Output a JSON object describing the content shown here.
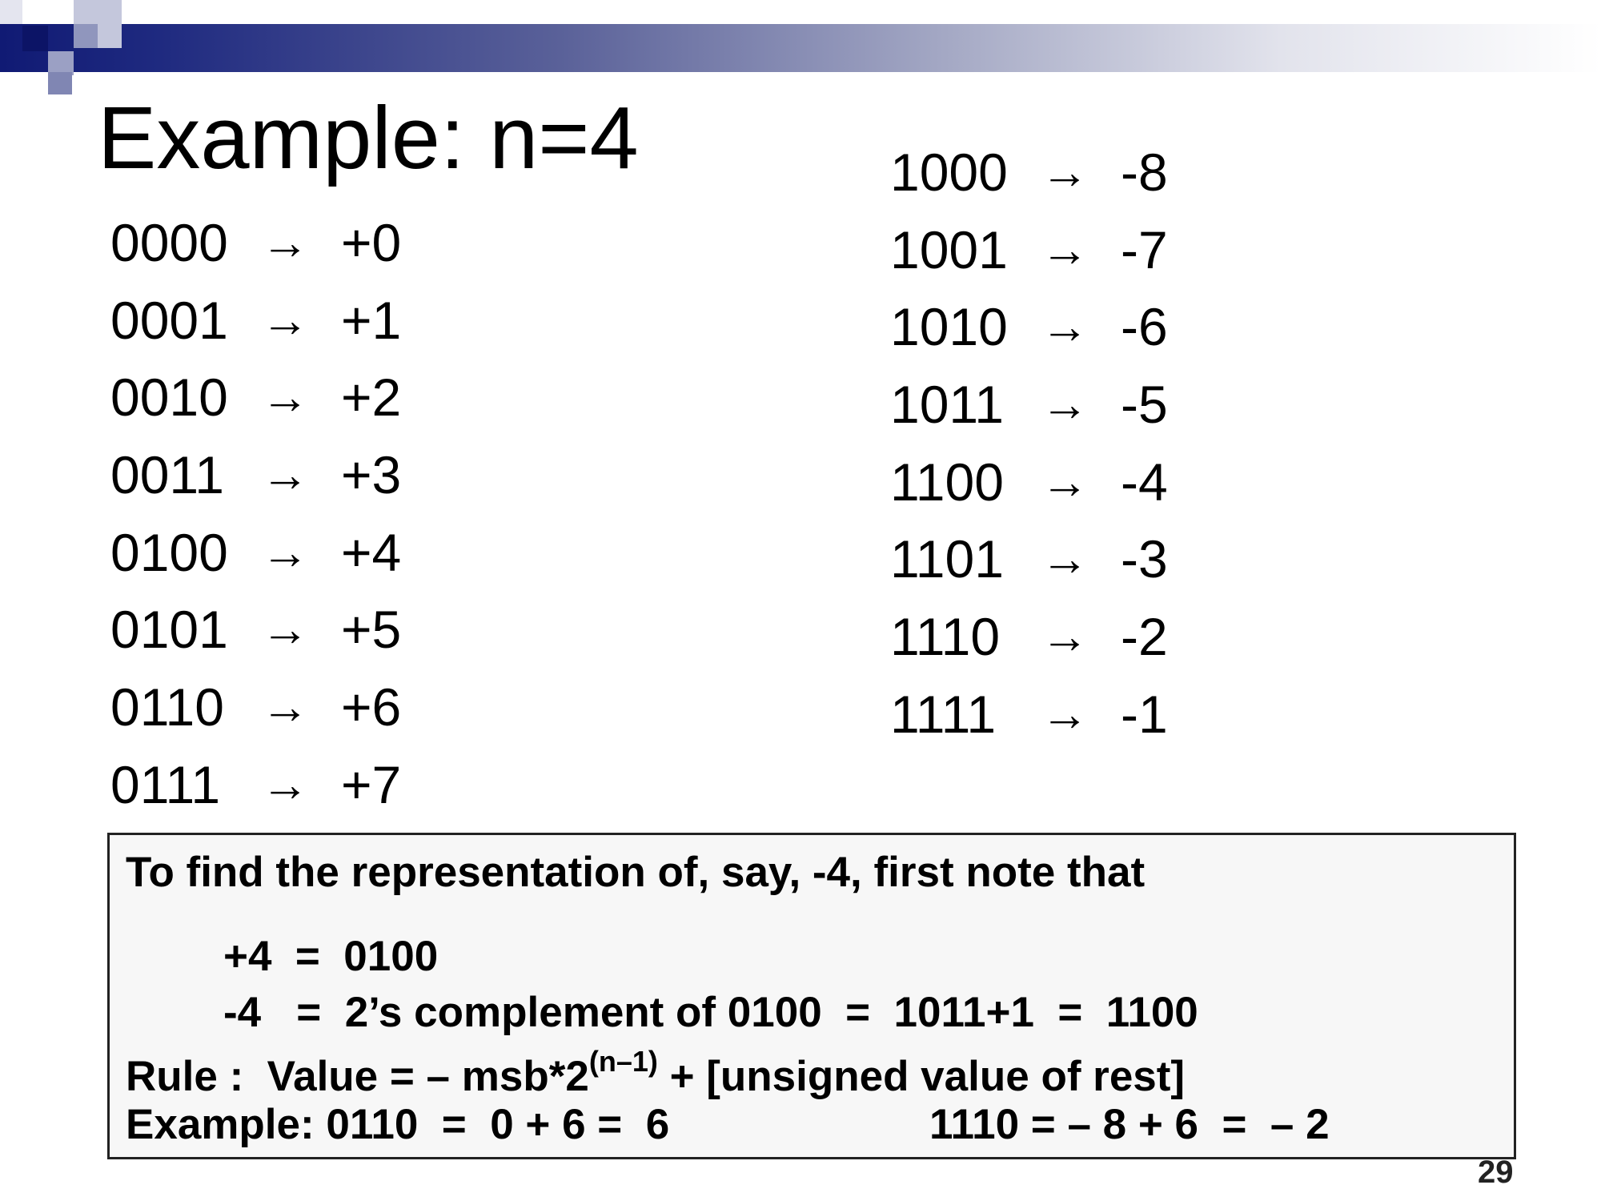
{
  "slide": {
    "title": "Example:  n=4",
    "page_number": "29"
  },
  "mapping": {
    "arrow": "→",
    "left": [
      {
        "bits": "0000",
        "value": "+0"
      },
      {
        "bits": "0001",
        "value": "+1"
      },
      {
        "bits": "0010",
        "value": "+2"
      },
      {
        "bits": "0011",
        "value": "+3"
      },
      {
        "bits": "0100",
        "value": "+4"
      },
      {
        "bits": "0101",
        "value": "+5"
      },
      {
        "bits": "0110",
        "value": "+6"
      },
      {
        "bits": "0111",
        "value": "+7"
      }
    ],
    "right": [
      {
        "bits": "1000",
        "value": "-8"
      },
      {
        "bits": "1001",
        "value": "-7"
      },
      {
        "bits": "1010",
        "value": "-6"
      },
      {
        "bits": "1011",
        "value": "-5"
      },
      {
        "bits": "1100",
        "value": "-4"
      },
      {
        "bits": "1101",
        "value": "-3"
      },
      {
        "bits": "1110",
        "value": "-2"
      },
      {
        "bits": "1111",
        "value": "-1"
      }
    ]
  },
  "note": {
    "line1": "To find the representation of, say, -4, first note that",
    "line2": "+4  =  0100",
    "line3": "-4   =  2’s complement of 0100  =  1011+1  =  1100",
    "rule_prefix": "Rule :  Value = – msb*2",
    "rule_exponent": "(n–1)",
    "rule_suffix": " + [unsigned value of rest]",
    "example_left": "Example: 0110  =  0 + 6 =  6",
    "example_right": "1110 = – 8 + 6  =  – 2"
  }
}
